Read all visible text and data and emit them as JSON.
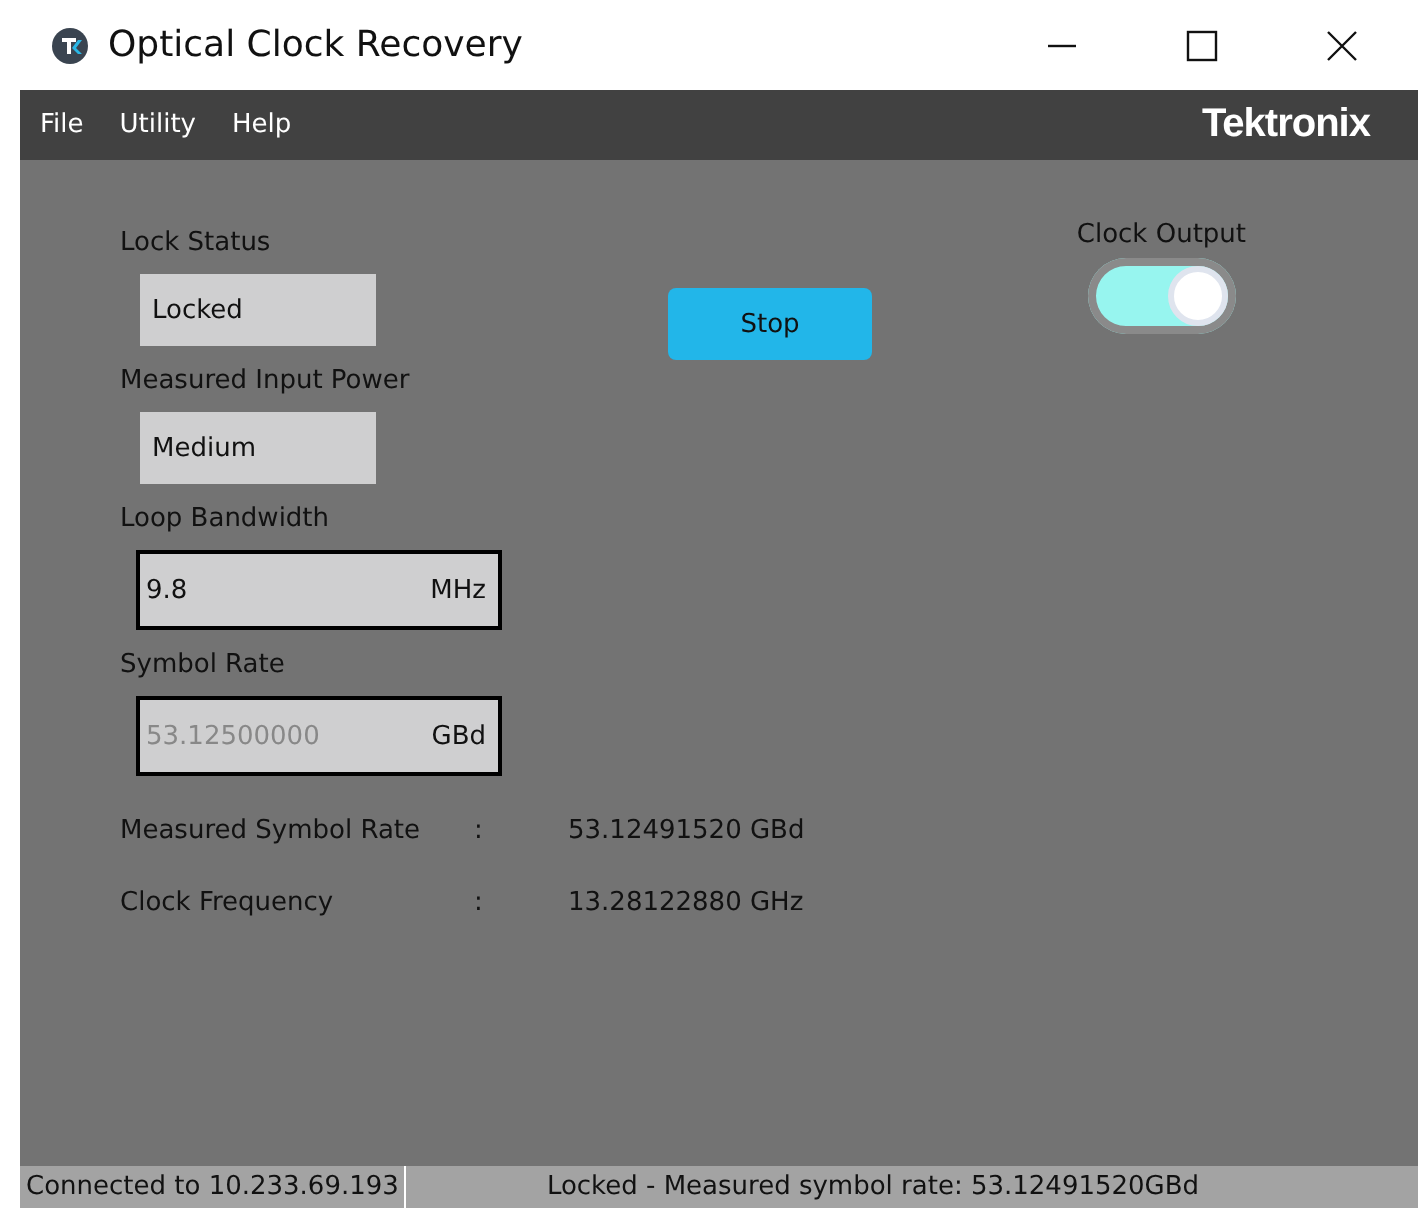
{
  "window": {
    "title": "Optical Clock Recovery"
  },
  "menu": [
    "File",
    "Utility",
    "Help"
  ],
  "brand": "Tektronix",
  "fields": [
    {
      "kind": "readout",
      "label": "Lock Status",
      "value": "Locked"
    },
    {
      "kind": "readout",
      "label": "Measured Input Power",
      "value": "Medium"
    },
    {
      "kind": "input",
      "label": "Loop Bandwidth",
      "value": "9.8",
      "unit": "MHz",
      "disabled": false
    },
    {
      "kind": "input",
      "label": "Symbol Rate",
      "value": "53.12500000",
      "unit": "GBd",
      "disabled": true
    }
  ],
  "stop_button": "Stop",
  "clock_output": {
    "label": "Clock Output",
    "on": true
  },
  "measurements": [
    {
      "label": "Measured Symbol Rate",
      "separator": ":",
      "value": "53.12491520 GBd"
    },
    {
      "label": "Clock Frequency",
      "separator": ":",
      "value": "13.28122880 GHz"
    }
  ],
  "status_bar": [
    "Connected to 10.233.69.193",
    "Locked - Measured symbol rate: 53.12491520GBd"
  ]
}
